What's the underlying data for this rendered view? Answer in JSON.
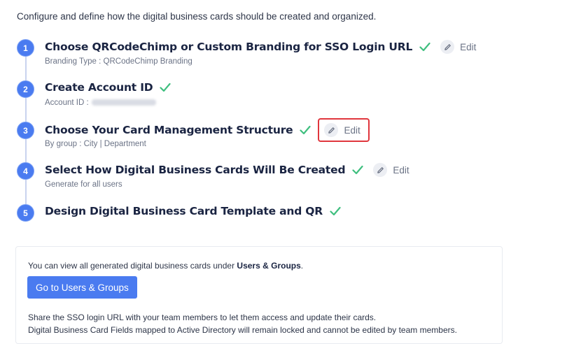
{
  "intro": "Configure and define how the digital business cards should be created and organized.",
  "steps": [
    {
      "num": "1",
      "title": "Choose QRCodeChimp or Custom Branding for SSO Login URL",
      "sub": "Branding Type : QRCodeChimp Branding",
      "edit": "Edit"
    },
    {
      "num": "2",
      "title": "Create Account ID",
      "sub": "Account ID :"
    },
    {
      "num": "3",
      "title": "Choose Your Card Management Structure",
      "sub": "By group : City | Department",
      "edit": "Edit"
    },
    {
      "num": "4",
      "title": "Select How Digital Business Cards Will Be Created",
      "sub": "Generate for all users",
      "edit": "Edit"
    },
    {
      "num": "5",
      "title": "Design Digital Business Card Template and QR"
    }
  ],
  "panel": {
    "text1_prefix": "You can view all generated digital business cards under",
    "text1_link": "Users & Groups",
    "text1_suffix": ".",
    "button": "Go to Users & Groups",
    "text2": "Share the SSO login URL with your team members to let them access and update their cards.",
    "text3": "Digital Business Card Fields mapped to Active Directory will remain locked and cannot be edited by team members."
  },
  "colors": {
    "accent": "#4a7bf0",
    "check": "#3fbf7f",
    "highlight": "#e0363d"
  },
  "icons": {
    "check": "check-icon",
    "edit": "pencil-icon"
  }
}
